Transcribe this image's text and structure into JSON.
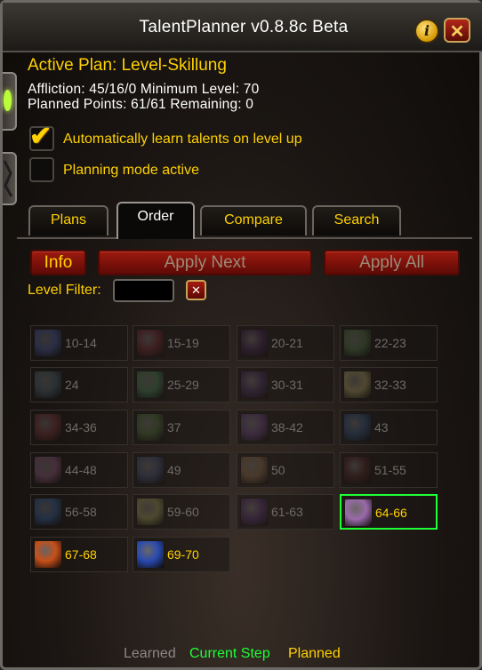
{
  "window": {
    "title": "TalentPlanner v0.8.8c Beta",
    "info_glyph": "i",
    "close_glyph": "✕"
  },
  "plan": {
    "name": "Active Plan: Level-Skillung",
    "line1": "Affliction: 45/16/0  Minimum Level: 70",
    "line2": "Planned Points: 61/61  Remaining: 0"
  },
  "options": {
    "auto_learn": {
      "label": "Automatically learn talents on level up",
      "checked": true
    },
    "planning_mode": {
      "label": "Planning mode active",
      "checked": false
    }
  },
  "tabs": [
    {
      "label": "Plans",
      "active": false
    },
    {
      "label": "Order",
      "active": true
    },
    {
      "label": "Compare",
      "active": false
    },
    {
      "label": "Search",
      "active": false
    }
  ],
  "actions": {
    "info": "Info",
    "apply_next": "Apply Next",
    "apply_all": "Apply All"
  },
  "filter": {
    "label": "Level Filter:",
    "value": "",
    "clear_glyph": "✕"
  },
  "steps": [
    {
      "range": "10-14",
      "state": "learned",
      "icon": "shadow-bolt-icon",
      "color": "#3a4fb0"
    },
    {
      "range": "15-19",
      "state": "learned",
      "icon": "blood-claw-icon",
      "color": "#8a1f28"
    },
    {
      "range": "20-21",
      "state": "learned",
      "icon": "dark-pact-icon",
      "color": "#4a1f5a"
    },
    {
      "range": "22-23",
      "state": "learned",
      "icon": "green-imp-icon",
      "color": "#3a6a2a"
    },
    {
      "range": "24",
      "state": "learned",
      "icon": "dark-wing-icon",
      "color": "#3a5a6a"
    },
    {
      "range": "25-29",
      "state": "learned",
      "icon": "green-flame-icon",
      "color": "#2a7a3a"
    },
    {
      "range": "30-31",
      "state": "learned",
      "icon": "purple-mist-icon",
      "color": "#4a2a6a"
    },
    {
      "range": "32-33",
      "state": "learned",
      "icon": "golden-beast-icon",
      "color": "#a08a3a"
    },
    {
      "range": "34-36",
      "state": "learned",
      "icon": "red-wing-icon",
      "color": "#8a2a2a"
    },
    {
      "range": "37",
      "state": "learned",
      "icon": "green-hand-icon",
      "color": "#3a6a1a"
    },
    {
      "range": "38-42",
      "state": "learned",
      "icon": "purple-shade-icon",
      "color": "#6a3a8a"
    },
    {
      "range": "43",
      "state": "learned",
      "icon": "blue-dragon-icon",
      "color": "#1f4a8a"
    },
    {
      "range": "44-48",
      "state": "learned",
      "icon": "pink-rune-icon",
      "color": "#9a4a7a"
    },
    {
      "range": "49",
      "state": "learned",
      "icon": "blade-icon",
      "color": "#3a4a7a"
    },
    {
      "range": "50",
      "state": "learned",
      "icon": "golden-serpent-icon",
      "color": "#8a5a2a"
    },
    {
      "range": "51-55",
      "state": "learned",
      "icon": "demon-face-icon",
      "color": "#5a1f1a"
    },
    {
      "range": "56-58",
      "state": "learned",
      "icon": "blue-swirl-icon",
      "color": "#1f5aaa"
    },
    {
      "range": "59-60",
      "state": "learned",
      "icon": "yellow-toad-icon",
      "color": "#8a8a2a"
    },
    {
      "range": "61-63",
      "state": "learned",
      "icon": "void-grasp-icon",
      "color": "#5a2a7a"
    },
    {
      "range": "64-66",
      "state": "current",
      "icon": "beast-roar-icon",
      "color": "#9a6aaa"
    },
    {
      "range": "67-68",
      "state": "planned",
      "icon": "fire-slash-icon",
      "color": "#c8501a"
    },
    {
      "range": "69-70",
      "state": "planned",
      "icon": "blue-spirit-icon",
      "color": "#2a4ab0"
    }
  ],
  "legend": {
    "learned": "Learned",
    "current": "Current Step",
    "planned": "Planned"
  },
  "colors": {
    "accent_gold": "#ffd100",
    "current_green": "#1fff36",
    "learned_gray": "#6e6a66",
    "button_red": "#9d1a0f"
  }
}
